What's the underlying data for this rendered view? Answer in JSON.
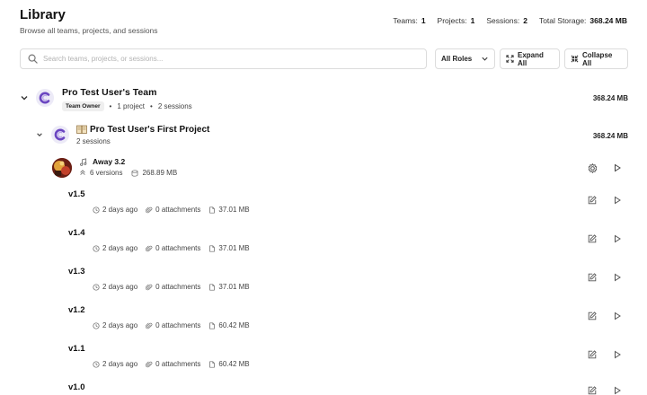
{
  "header": {
    "title": "Library",
    "subtitle": "Browse all teams, projects, and sessions",
    "stats": [
      {
        "label": "Teams:",
        "value": "1"
      },
      {
        "label": "Projects:",
        "value": "1"
      },
      {
        "label": "Sessions:",
        "value": "2"
      },
      {
        "label": "Total Storage:",
        "value": "368.24 MB"
      }
    ]
  },
  "toolbar": {
    "search_placeholder": "Search teams, projects, or sessions...",
    "roles_label": "All Roles",
    "expand_label": "Expand All",
    "collapse_label": "Collapse All"
  },
  "team": {
    "name": "Pro Test User's Team",
    "role": "Team Owner",
    "projects": "1 project",
    "sessions": "2 sessions",
    "size": "368.24 MB"
  },
  "project": {
    "name": "Pro Test User's First Project",
    "sessions": "2 sessions",
    "size": "368.24 MB"
  },
  "session": {
    "name": "Away 3.2",
    "versions": "6 versions",
    "size": "268.89 MB"
  },
  "versions": [
    {
      "name": "v1.5",
      "time": "2 days ago",
      "attachments": "0 attachments",
      "size": "37.01 MB"
    },
    {
      "name": "v1.4",
      "time": "2 days ago",
      "attachments": "0 attachments",
      "size": "37.01 MB"
    },
    {
      "name": "v1.3",
      "time": "2 days ago",
      "attachments": "0 attachments",
      "size": "37.01 MB"
    },
    {
      "name": "v1.2",
      "time": "2 days ago",
      "attachments": "0 attachments",
      "size": "60.42 MB"
    },
    {
      "name": "v1.1",
      "time": "2 days ago",
      "attachments": "0 attachments",
      "size": "60.42 MB"
    },
    {
      "name": "v1.0",
      "time": "",
      "attachments": "",
      "size": ""
    }
  ],
  "colors": {
    "logo_purple": "#6b46c1",
    "logo_bg": "#eceaf7",
    "border": "#dcdcdc",
    "muted_text": "#555555"
  }
}
